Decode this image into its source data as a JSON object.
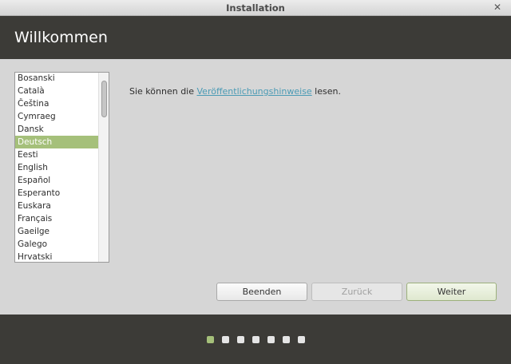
{
  "window": {
    "title": "Installation"
  },
  "header": {
    "title": "Willkommen"
  },
  "languages": {
    "items": [
      "Bosanski",
      "Català",
      "Čeština",
      "Cymraeg",
      "Dansk",
      "Deutsch",
      "Eesti",
      "English",
      "Español",
      "Esperanto",
      "Euskara",
      "Français",
      "Gaeilge",
      "Galego",
      "Hrvatski"
    ],
    "selected": "Deutsch"
  },
  "notes": {
    "prefix": "Sie können die ",
    "link": "Veröffentlichungshinweise",
    "suffix": " lesen."
  },
  "buttons": {
    "quit": "Beenden",
    "back": "Zurück",
    "next": "Weiter"
  },
  "progress": {
    "total_steps": 7,
    "current_step": 1
  },
  "colors": {
    "accent": "#a5c07a",
    "header_bg": "#3c3b37",
    "link": "#4b9bb5"
  }
}
